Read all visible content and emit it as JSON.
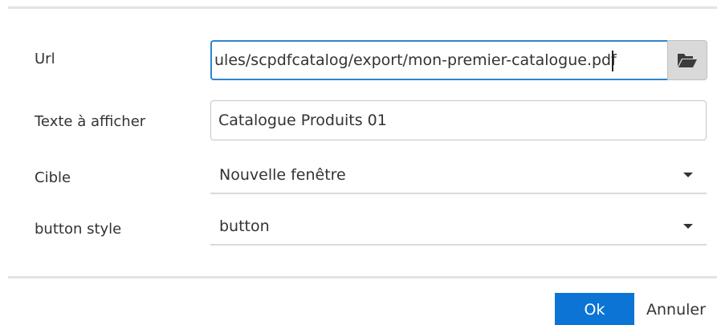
{
  "form": {
    "url": {
      "label": "Url",
      "value": "ules/scpdfcatalog/export/mon-premier-catalogue.pdf",
      "browse_icon": "folder-open-icon"
    },
    "text_to_display": {
      "label": "Texte à afficher",
      "value": "Catalogue Produits 01"
    },
    "target": {
      "label": "Cible",
      "selected": "Nouvelle fenêtre"
    },
    "button_style": {
      "label": "button style",
      "selected": "button"
    }
  },
  "actions": {
    "ok_label": "Ok",
    "cancel_label": "Annuler"
  },
  "colors": {
    "accent": "#0b74d4",
    "focus_border": "#2f84d0"
  }
}
